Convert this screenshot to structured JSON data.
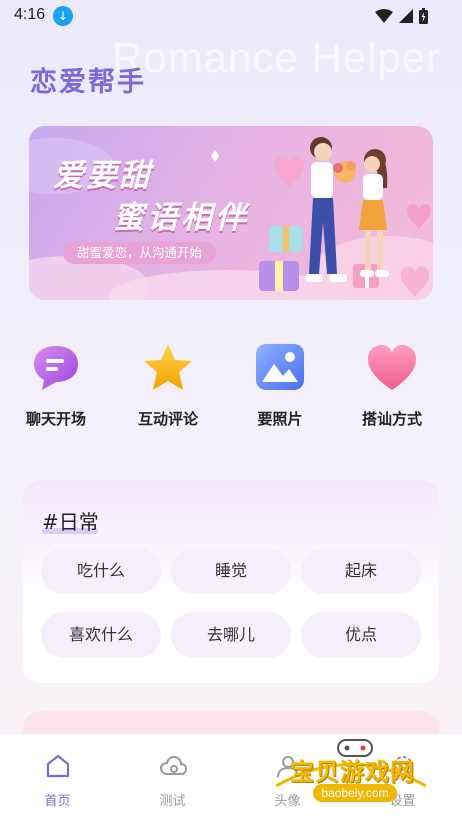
{
  "status_bar": {
    "time": "4:16"
  },
  "header": {
    "title": "恋爱帮手",
    "bg_title": "Romance Helper"
  },
  "banner": {
    "line1": "爱要甜",
    "line2": "蜜语相伴",
    "tagline": "甜蜜爱恋，从沟通开始"
  },
  "quick_actions": [
    {
      "label": "聊天开场",
      "icon": "chat-bubble-icon"
    },
    {
      "label": "互动评论",
      "icon": "star-icon"
    },
    {
      "label": "要照片",
      "icon": "image-icon"
    },
    {
      "label": "搭讪方式",
      "icon": "heart-icon"
    }
  ],
  "topic_card": {
    "title": "#日常",
    "chips": [
      "吃什么",
      "睡觉",
      "起床",
      "喜欢什么",
      "去哪儿",
      "优点"
    ]
  },
  "tabbar": {
    "tabs": [
      {
        "label": "首页",
        "icon": "home-icon",
        "active": true
      },
      {
        "label": "测试",
        "icon": "cloud-icon",
        "active": false
      },
      {
        "label": "头像",
        "icon": "avatar-icon",
        "active": false
      },
      {
        "label": "设置",
        "icon": "settings-icon",
        "active": false
      }
    ]
  },
  "watermark": {
    "text": "宝贝游戏网",
    "sub": "baobeiy.com"
  },
  "colors": {
    "accent": "#7d6ad8",
    "tag_pink": "#e8a2d5",
    "watermark": "#f2b705"
  }
}
